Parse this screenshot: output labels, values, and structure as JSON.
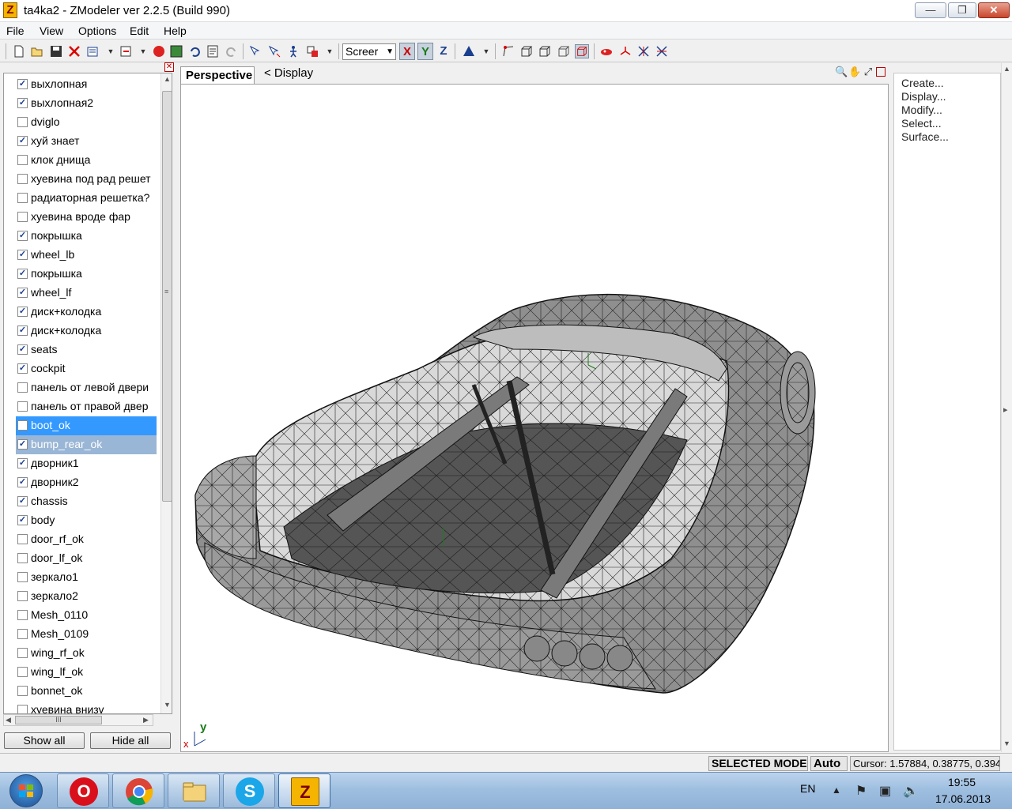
{
  "window": {
    "title": "ta4ka2 - ZModeler ver 2.2.5 (Build 990)",
    "logo_letter": "Z",
    "minimize_label": "—",
    "maximize_label": "❐",
    "close_label": "✕"
  },
  "menu": [
    "File",
    "View",
    "Options",
    "Edit",
    "Help"
  ],
  "toolbar": {
    "view_combo": "Screer",
    "axis_x": "X",
    "axis_y": "Y",
    "axis_z": "Z",
    "icons": [
      "new-icon",
      "open-icon",
      "save-icon",
      "delete-icon",
      "import-icon",
      "export-icon",
      "render-icon",
      "material-icon",
      "undo-icon",
      "notes-icon",
      "redo-icon",
      "select-icon",
      "select-hierarchy-icon",
      "move-icon",
      "scale-icon",
      "triangle-icon",
      "vertex-icon",
      "box-icon",
      "box-select-icon",
      "box-mode-icon",
      "box-active-icon",
      "paint-icon",
      "gizmo-icon",
      "cross-icon",
      "cross-select-icon"
    ]
  },
  "objects": {
    "items": [
      {
        "label": "выхлопная",
        "checked": true
      },
      {
        "label": "выхлопная2",
        "checked": true
      },
      {
        "label": "dviglo",
        "checked": false
      },
      {
        "label": "хуй знает",
        "checked": true
      },
      {
        "label": "клок днища",
        "checked": false
      },
      {
        "label": "хуевина под рад решет",
        "checked": false
      },
      {
        "label": "радиаторная решетка?",
        "checked": false
      },
      {
        "label": "хуевина вроде фар",
        "checked": false
      },
      {
        "label": "покрышка",
        "checked": true
      },
      {
        "label": "wheel_lb",
        "checked": true
      },
      {
        "label": "покрышка",
        "checked": true
      },
      {
        "label": "wheel_lf",
        "checked": true
      },
      {
        "label": "диск+колодка",
        "checked": true
      },
      {
        "label": "диск+колодка",
        "checked": true
      },
      {
        "label": "seats",
        "checked": true
      },
      {
        "label": "cockpit",
        "checked": true
      },
      {
        "label": "панель от левой двери",
        "checked": false
      },
      {
        "label": "панель от правой двер",
        "checked": false
      },
      {
        "label": "boot_ok",
        "checked": false,
        "selected": "primary"
      },
      {
        "label": "bump_rear_ok",
        "checked": true,
        "selected": "secondary"
      },
      {
        "label": "дворник1",
        "checked": true
      },
      {
        "label": "дворник2",
        "checked": true
      },
      {
        "label": "chassis",
        "checked": true
      },
      {
        "label": "body",
        "checked": true
      },
      {
        "label": "door_rf_ok",
        "checked": false
      },
      {
        "label": "door_lf_ok",
        "checked": false
      },
      {
        "label": "зеркало1",
        "checked": false
      },
      {
        "label": "зеркало2",
        "checked": false
      },
      {
        "label": "Mesh_0110",
        "checked": false
      },
      {
        "label": "Mesh_0109",
        "checked": false
      },
      {
        "label": "wing_rf_ok",
        "checked": false
      },
      {
        "label": "wing_lf_ok",
        "checked": false
      },
      {
        "label": "bonnet_ok",
        "checked": false
      },
      {
        "label": "хуевина внизу",
        "checked": false
      }
    ],
    "show_all": "Show all",
    "hide_all": "Hide all",
    "hscroll_grip": "III",
    "vscroll_grip": "≡"
  },
  "viewport": {
    "tab": "Perspective",
    "display_label": "<  Display",
    "gizmo_y": "y",
    "gizmo_x": "x"
  },
  "commands": [
    "Create...",
    "Display...",
    "Modify...",
    "Select...",
    "Surface..."
  ],
  "status": {
    "mode": "SELECTED MODE",
    "auto": "Auto",
    "cursor": "Cursor: 1.57884, 0.38775, 0.3941"
  },
  "tray": {
    "lang": "EN",
    "time": "19:55",
    "date": "17.06.2013"
  },
  "taskbar": {
    "apps": [
      "opera",
      "chrome",
      "explorer",
      "skype",
      "zmodeler"
    ],
    "opera_glyph": "O",
    "skype_glyph": "S",
    "zmodeler_glyph": "Z"
  }
}
